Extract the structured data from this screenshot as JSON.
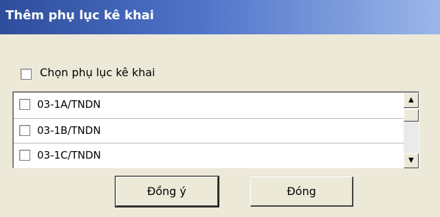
{
  "window": {
    "title": "Thêm phụ lục kê khai"
  },
  "select_all": {
    "label": "Chọn phụ lục kê khai",
    "checked": false
  },
  "list": {
    "items": [
      {
        "label": "03-1A/TNDN",
        "checked": false
      },
      {
        "label": "03-1B/TNDN",
        "checked": false
      },
      {
        "label": "03-1C/TNDN",
        "checked": false
      }
    ]
  },
  "buttons": {
    "ok_label": "Đồng ý",
    "close_label": "Đóng"
  },
  "icons": {
    "scroll_up": "scroll-up-arrow-icon",
    "scroll_down": "scroll-down-arrow-icon"
  },
  "colors": {
    "title_gradient_start": "#2e4d9b",
    "title_gradient_end": "#9bb6e9",
    "window_bg": "#ece9d8"
  }
}
